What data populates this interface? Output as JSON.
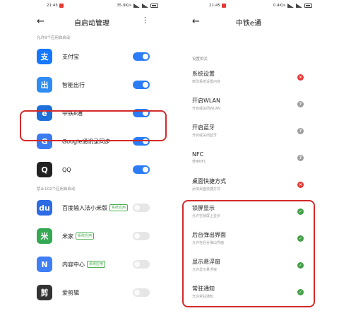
{
  "left": {
    "status": {
      "time": "21:45",
      "net": "35.9K/s"
    },
    "header": {
      "back_glyph": "←",
      "title": "自启动管理",
      "more_glyph": "⋮"
    },
    "section_allowed": "允许9个应用自启动",
    "section_blocked": "禁止102个应用自启动",
    "apps": [
      {
        "name": "支付宝",
        "icon": "alipay-icon",
        "glyph": "支",
        "color": "#1677ff",
        "toggle": true
      },
      {
        "name": "智能出行",
        "icon": "smart-travel-icon",
        "glyph": "出",
        "color": "#2f8cf2",
        "toggle": true
      },
      {
        "name": "中铁e通",
        "icon": "crec-etong-icon",
        "glyph": "e",
        "color": "#1e6fd9",
        "toggle": true
      },
      {
        "name": "Google通讯录同步",
        "icon": "google-contacts-icon",
        "glyph": "G",
        "color": "#3b7bf0",
        "toggle": true
      },
      {
        "name": "QQ",
        "icon": "qq-icon",
        "glyph": "Q",
        "color": "#222222",
        "toggle": true
      }
    ],
    "blocked_apps": [
      {
        "name": "百度输入法小米版",
        "tag": "系统应用",
        "icon": "baidu-ime-icon",
        "glyph": "du",
        "color": "#2d6be4",
        "toggle": false
      },
      {
        "name": "米家",
        "tag": "系统应用",
        "icon": "mijia-icon",
        "glyph": "米",
        "color": "#34a853",
        "toggle": false
      },
      {
        "name": "内容中心",
        "tag": "系统应用",
        "icon": "content-center-icon",
        "glyph": "N",
        "color": "#3f7ef5",
        "toggle": false
      },
      {
        "name": "爱剪辑",
        "tag": "",
        "icon": "aijianji-icon",
        "glyph": "剪",
        "color": "#333333",
        "toggle": false
      }
    ]
  },
  "right": {
    "status": {
      "time": "21:45",
      "net": "0.4K/s"
    },
    "header": {
      "back_glyph": "←",
      "title": "中铁e通"
    },
    "section": "设置相关",
    "permissions": [
      {
        "title": "系统设置",
        "sub": "修改系统设置内容",
        "state": "deny",
        "glyph": "×"
      },
      {
        "title": "开启WLAN",
        "sub": "开启或关闭WLAN",
        "state": "ask",
        "glyph": "?"
      },
      {
        "title": "开启蓝牙",
        "sub": "开启或关闭蓝牙",
        "state": "ask",
        "glyph": "?"
      },
      {
        "title": "NFC",
        "sub": "使用NFC",
        "state": "ask",
        "glyph": "?"
      },
      {
        "title": "桌面快捷方式",
        "sub": "添加桌面快捷方式",
        "state": "deny",
        "glyph": "×"
      },
      {
        "title": "锁屏显示",
        "sub": "允许在锁屏上显示",
        "state": "allow",
        "glyph": "✓"
      },
      {
        "title": "后台弹出界面",
        "sub": "允许在后台弹出界面",
        "state": "allow",
        "glyph": "✓"
      },
      {
        "title": "显示悬浮窗",
        "sub": "允许显示悬浮窗",
        "state": "allow",
        "glyph": "✓"
      },
      {
        "title": "常驻通知",
        "sub": "允许常驻通知",
        "state": "allow",
        "glyph": "✓"
      }
    ]
  },
  "colors": {
    "accent": "#2b7cf6",
    "highlight": "#d42a2a",
    "allow": "#43a047",
    "deny": "#e53935",
    "ask": "#9e9e9e"
  }
}
